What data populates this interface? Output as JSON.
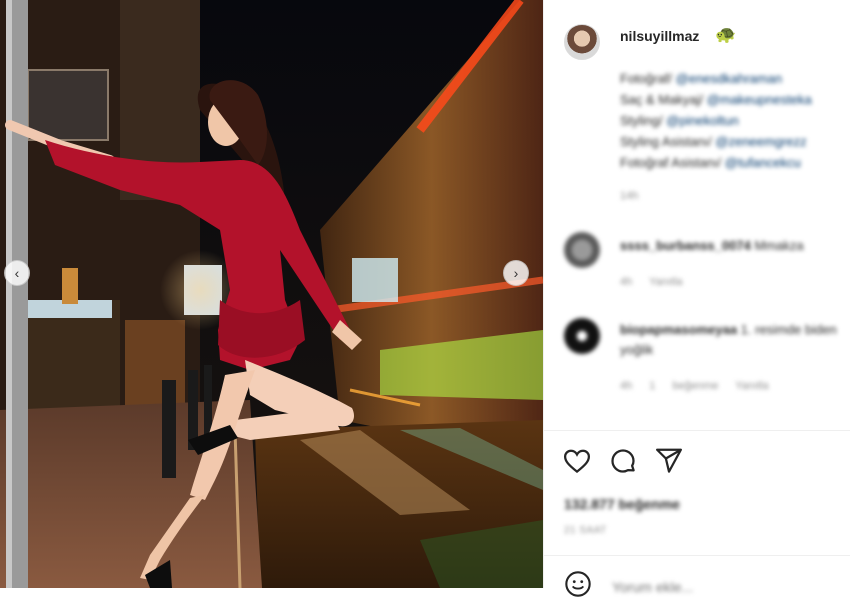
{
  "post": {
    "username": "nilsuyillmaz",
    "caption_lines": [
      {
        "label": "Fotoğraf/ ",
        "tag": "@enesdkahraman"
      },
      {
        "label": "Saç & Makyaj/ ",
        "tag": "@makeupnesteka"
      },
      {
        "label": "Styling/ ",
        "tag": "@pinekoltun"
      },
      {
        "label": "Styling Asistanı/ ",
        "tag": "@zeneemgrezz"
      },
      {
        "label": "Fotoğraf Asistanı/ ",
        "tag": "@tufancekcu"
      }
    ],
    "caption_time": "14h"
  },
  "comments": [
    {
      "user": "ssss_burbanss_0074",
      "text": "Mmakza",
      "meta": "4h Yanıtla"
    },
    {
      "user": "biopapmasomeyaa",
      "text": "1. resimde biden yoğlik",
      "meta": "4h 1 beğenme Yanıtla"
    }
  ],
  "likes_text": "132.877 beğenme",
  "post_time": "21 SAAT",
  "comment_placeholder": "Yorum ekle...",
  "icons": {
    "prev": "chevron-left-icon",
    "next": "chevron-right-icon",
    "like": "heart-icon",
    "comment": "comment-icon",
    "share": "share-icon",
    "emoji": "smiley-icon",
    "badge": "turtle-icon"
  },
  "colors": {
    "dress": "#b3122b",
    "night_sky": "#0b0b10",
    "streak": "#ff5a2a",
    "green_light": "#b6ff4a",
    "tag": "#00376b"
  }
}
